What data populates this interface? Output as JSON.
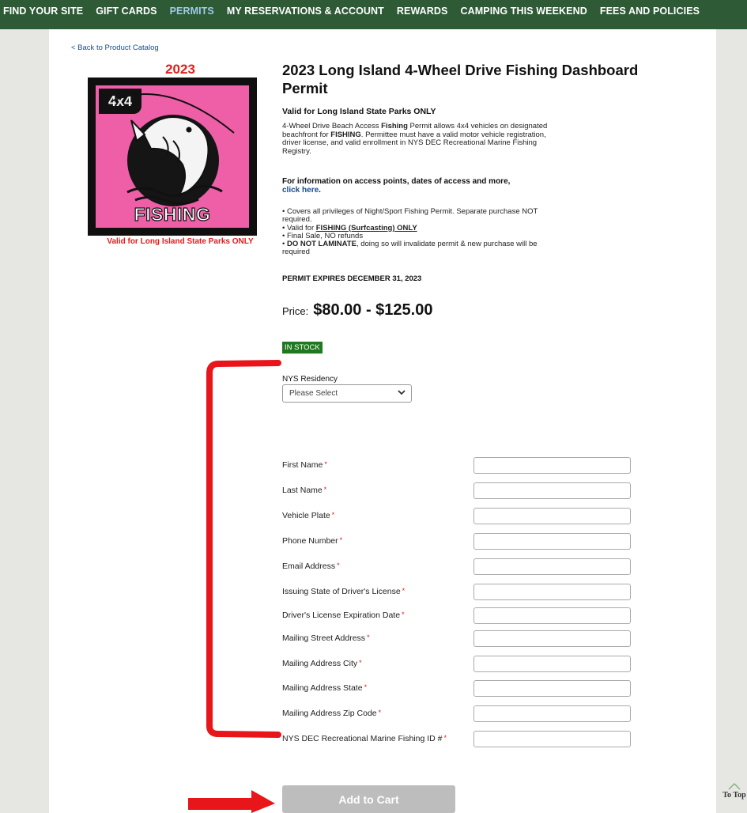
{
  "nav": {
    "items": [
      "FIND YOUR SITE",
      "GIFT CARDS",
      "PERMITS",
      "MY RESERVATIONS & ACCOUNT",
      "REWARDS",
      "CAMPING THIS WEEKEND",
      "FEES AND POLICIES"
    ],
    "active": "PERMITS"
  },
  "back_link": "< Back to Product Catalog",
  "product_image": {
    "year": "2023",
    "badge": "4x4",
    "word": "FISHING",
    "caption": "Valid for Long Island State Parks ONLY",
    "pink_color": "#ef5fa8"
  },
  "product": {
    "title": "2023 Long Island 4-Wheel Drive Fishing Dashboard Permit",
    "valid": "Valid for Long Island State Parks ONLY",
    "desc_a": "4-Wheel Drive Beach Access ",
    "desc_b": "Fishing",
    "desc_c": " Permit allows 4x4 vehicles on designated beachfront for ",
    "desc_d": "FISHING",
    "desc_e": ". Permittee must have a valid motor vehicle registration, driver license, and valid enrollment in NYS DEC Recreational Marine Fishing Registry.",
    "info_text": "For information on access points, dates of access and more,",
    "info_link": "click here",
    "info_end": ".",
    "bullet1": "•  Covers all privileges of Night/Sport Fishing Permit. Separate purchase NOT required.",
    "bullet2_a": "•  Valid for ",
    "bullet2_b": "FISHING (Surfcasting) ONLY",
    "bullet3": "•  Final Sale, NO refunds",
    "bullet4_a": "•  ",
    "bullet4_b": "DO NOT LAMINATE",
    "bullet4_c": ", doing so will invalidate permit & new purchase will be required",
    "expires": "PERMIT EXPIRES DECEMBER 31, 2023",
    "price_label": "Price:",
    "price_value": "$80.00 - $125.00",
    "stock": "IN STOCK"
  },
  "residency": {
    "label": "NYS Residency",
    "selected": "Please Select"
  },
  "form": {
    "required_mark": "*",
    "fields": [
      "First Name",
      "Last Name",
      "Vehicle Plate",
      "Phone Number",
      "Email Address",
      "Issuing State of Driver's License",
      "Driver's License Expiration Date",
      "Mailing Street Address",
      "Mailing Address City",
      "Mailing Address State",
      "Mailing Address Zip Code",
      "NYS DEC Recreational Marine Fishing ID #"
    ]
  },
  "add_to_cart": "Add to Cart",
  "to_top": "To Top",
  "annotation_color": "#e8151b"
}
